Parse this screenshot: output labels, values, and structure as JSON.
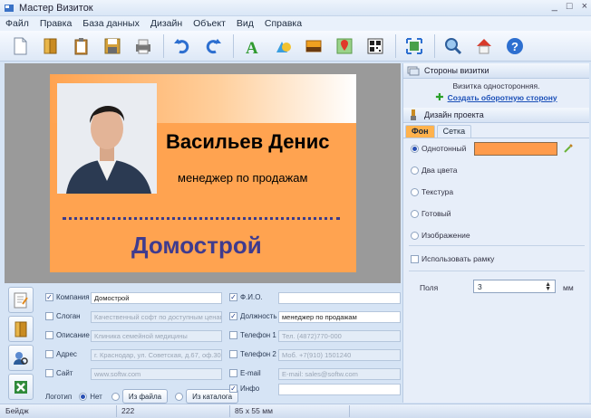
{
  "window": {
    "title": "Мастер Визиток",
    "minimize": "_",
    "maximize": "□",
    "close": "×"
  },
  "menu": [
    "Файл",
    "Правка",
    "База данных",
    "Дизайн",
    "Объект",
    "Вид",
    "Справка"
  ],
  "toolbar": [
    {
      "icon": "new-file-icon"
    },
    {
      "icon": "open-folder-icon"
    },
    {
      "icon": "clipboard-icon"
    },
    {
      "icon": "save-icon"
    },
    {
      "icon": "print-icon"
    },
    {
      "icon": "undo-icon"
    },
    {
      "icon": "redo-icon"
    },
    {
      "icon": "text-icon"
    },
    {
      "icon": "shapes-icon"
    },
    {
      "icon": "image-icon"
    },
    {
      "icon": "map-icon"
    },
    {
      "icon": "qr-code-icon"
    },
    {
      "icon": "fit-icon"
    },
    {
      "icon": "preview-icon"
    },
    {
      "icon": "home-icon"
    },
    {
      "icon": "help-icon"
    }
  ],
  "card": {
    "name": "Васильев Денис",
    "position": "менеджер по продажам",
    "company": "Домострой"
  },
  "form": {
    "company": {
      "label": "Компания",
      "value": "Домострой",
      "checked": true
    },
    "slogan": {
      "label": "Слоган",
      "placeholder": "Качественный софт по доступным ценам",
      "checked": false
    },
    "description": {
      "label": "Описание",
      "placeholder": "Клиника семейной медицины",
      "checked": false
    },
    "address": {
      "label": "Адрес",
      "placeholder": "г. Краснодар, ул. Советская, д.67, оф.302",
      "checked": false
    },
    "site": {
      "label": "Сайт",
      "placeholder": "www.softw.com",
      "checked": false
    },
    "fio": {
      "label": "Ф.И.О.",
      "value": "",
      "checked": true
    },
    "job": {
      "label": "Должность",
      "value": "менеджер по продажам",
      "checked": true
    },
    "phone1": {
      "label": "Телефон 1",
      "placeholder": "Тел. (4872)770-000",
      "checked": false
    },
    "phone2": {
      "label": "Телефон 2",
      "placeholder": "Моб. +7(910) 1501240",
      "checked": false
    },
    "email": {
      "label": "E-mail",
      "placeholder": "E-mail: sales@softw.com",
      "checked": false
    },
    "info": {
      "label": "Инфо",
      "value": "",
      "checked": true
    },
    "logo": {
      "label": "Логотип",
      "none": "Нет",
      "from_file": "Из файла",
      "from_catalog": "Из каталога"
    }
  },
  "right": {
    "sides_title": "Стороны визитки",
    "sides_info": "Визитка односторонняя.",
    "create_back": "Создать оборотную сторону",
    "design_title": "Дизайн проекта",
    "tabs": [
      "Фон",
      "Сетка"
    ],
    "options": [
      "Однотонный",
      "Два цвета",
      "Текстура",
      "Готовый",
      "Изображение"
    ],
    "selected_color": "#FF9B4B",
    "use_frame": "Использовать рамку",
    "margins_label": "Поля",
    "margins_value": "3",
    "unit": "мм"
  },
  "status": {
    "mode": "Бейдж",
    "number": "222",
    "size": "85 x 55 мм"
  }
}
